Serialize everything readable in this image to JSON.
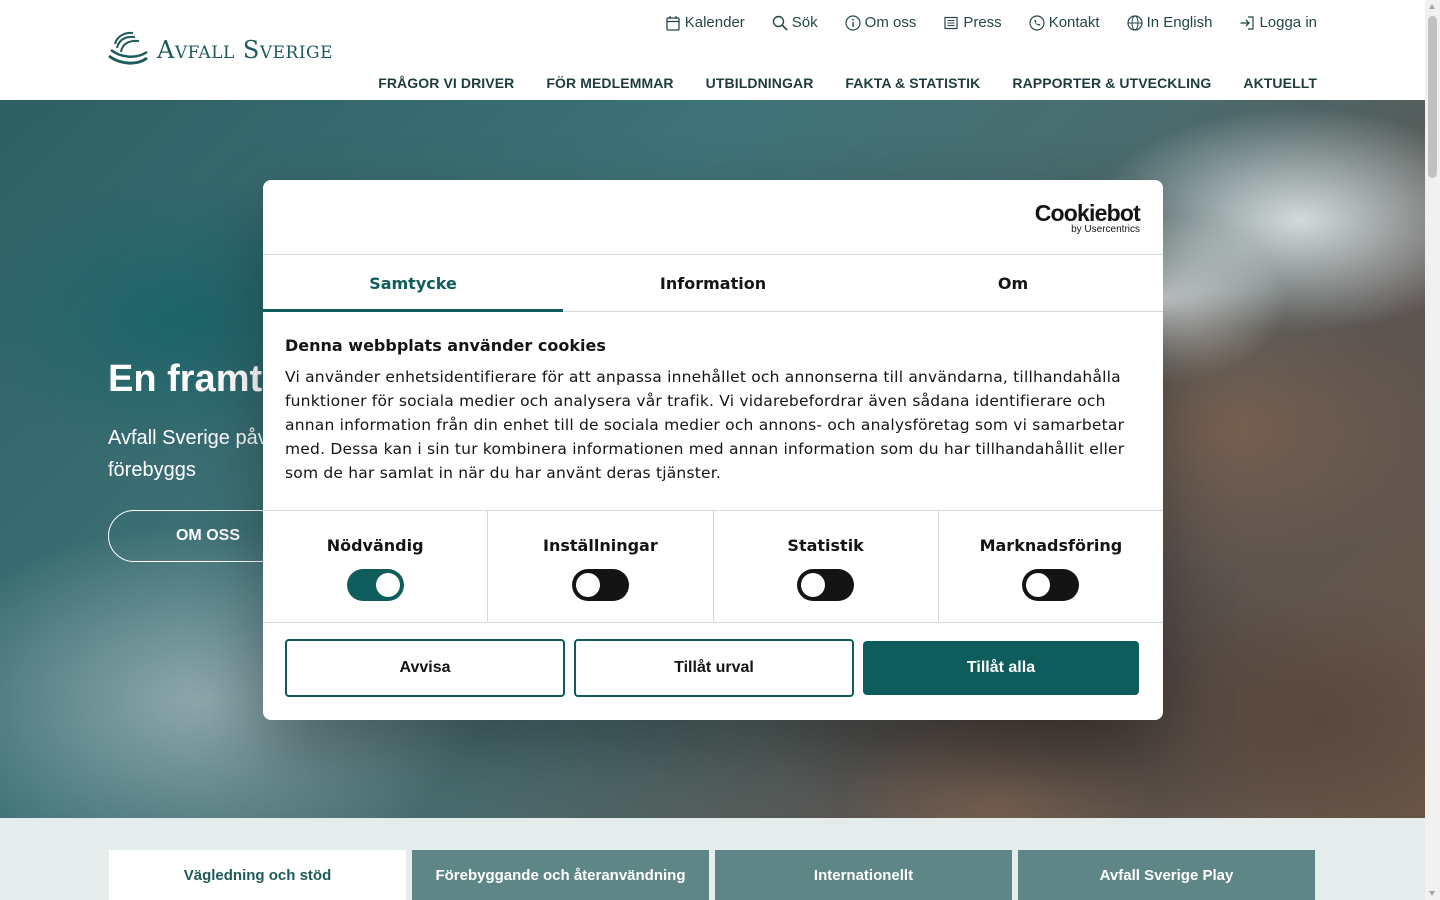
{
  "brand": {
    "name": "Avfall Sverige",
    "color": "#1d5a5a"
  },
  "utility_nav": [
    {
      "label": "Kalender",
      "icon": "calendar-icon"
    },
    {
      "label": "Sök",
      "icon": "search-icon"
    },
    {
      "label": "Om oss",
      "icon": "info-icon"
    },
    {
      "label": "Press",
      "icon": "newspaper-icon"
    },
    {
      "label": "Kontakt",
      "icon": "phone-icon"
    },
    {
      "label": "In English",
      "icon": "globe-icon"
    },
    {
      "label": "Logga in",
      "icon": "login-icon"
    }
  ],
  "main_nav": [
    "FRÅGOR VI DRIVER",
    "FÖR MEDLEMMAR",
    "UTBILDNINGAR",
    "FAKTA & STATISTIK",
    "RAPPORTER & UTVECKLING",
    "AKTUELLT"
  ],
  "hero": {
    "title": "En framtid",
    "text": "Avfall Sverige påverkar för en hållbar framtid där avfall förebyggs",
    "button": "OM OSS"
  },
  "lower_tabs": [
    {
      "label": "Vägledning och stöd",
      "active": true
    },
    {
      "label": "Förebyggande och återanvändning",
      "active": false
    },
    {
      "label": "Internationellt",
      "active": false
    },
    {
      "label": "Avfall Sverige Play",
      "active": false
    }
  ],
  "cookie_dialog": {
    "provider": "Cookiebot",
    "provider_sub": "by Usercentrics",
    "tabs": [
      {
        "label": "Samtycke",
        "active": true
      },
      {
        "label": "Information",
        "active": false
      },
      {
        "label": "Om",
        "active": false
      }
    ],
    "title": "Denna webbplats använder cookies",
    "text": "Vi använder enhetsidentifierare för att anpassa innehållet och annonserna till användarna, tillhandahålla funktioner för sociala medier och analysera vår trafik. Vi vidarebefordrar även sådana identifierare och annan information från din enhet till de sociala medier och annons- och analysföretag som vi samarbetar med. Dessa kan i sin tur kombinera informationen med annan information som du har tillhandahållit eller som de har samlat in när du har använt deras tjänster.",
    "toggles": [
      {
        "label": "Nödvändig",
        "on": true
      },
      {
        "label": "Inställningar",
        "on": false
      },
      {
        "label": "Statistik",
        "on": false
      },
      {
        "label": "Marknadsföring",
        "on": false
      }
    ],
    "buttons": {
      "reject": "Avvisa",
      "allow_selection": "Tillåt urval",
      "allow_all": "Tillåt alla"
    },
    "accent_color": "#0e5c5c"
  }
}
